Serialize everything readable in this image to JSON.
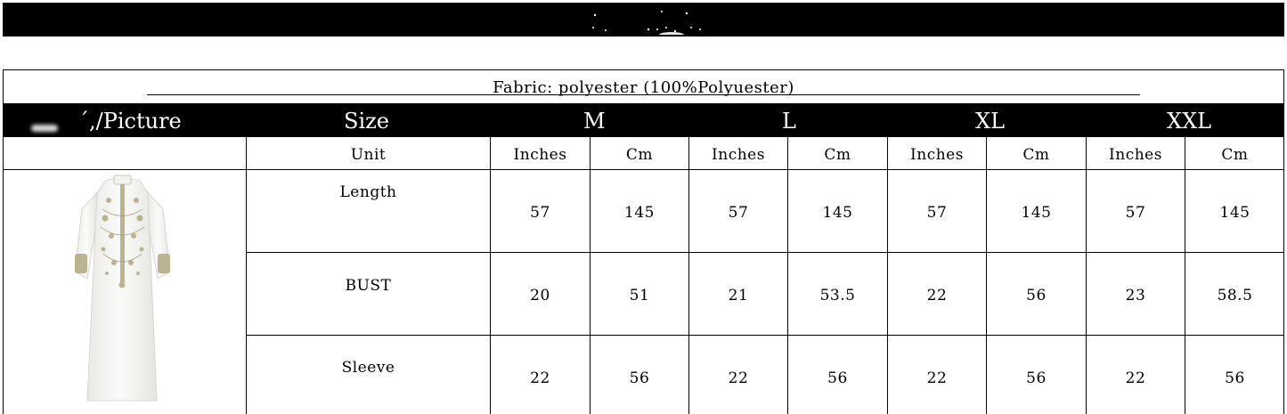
{
  "fabric": "Fabric: polyester (100%Polyuester)",
  "header": {
    "picture": "´,/Picture",
    "size": "Size",
    "sizes": [
      "M",
      "L",
      "XL",
      "XXL"
    ]
  },
  "unit_row": {
    "label": "Unit",
    "units": [
      "Inches",
      "Cm",
      "Inches",
      "Cm",
      "Inches",
      "Cm",
      "Inches",
      "Cm"
    ]
  },
  "rows": [
    {
      "label": "Length",
      "values": [
        "57",
        "145",
        "57",
        "145",
        "57",
        "145",
        "57",
        "145"
      ]
    },
    {
      "label": "BUST",
      "values": [
        "20",
        "51",
        "21",
        "53.5",
        "22",
        "56",
        "23",
        "58.5"
      ]
    },
    {
      "label": "Sleeve",
      "values": [
        "22",
        "56",
        "22",
        "56",
        "22",
        "56",
        "22",
        "56"
      ]
    }
  ],
  "image": {
    "subject": "white embroidered long dress"
  }
}
